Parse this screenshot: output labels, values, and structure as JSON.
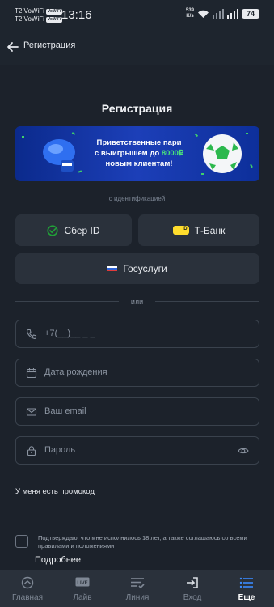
{
  "status_bar": {
    "carrier_line1": "T2 VoWiFi",
    "carrier_line2": "T2 VoWiFi",
    "volte_badge": "VoWiFi",
    "time": "13:16",
    "speed_value": "539",
    "speed_unit": "K/s",
    "battery": "74"
  },
  "header": {
    "title": "Регистрация"
  },
  "page_title": "Регистрация",
  "banner": {
    "line1": "Приветственные пари",
    "line2_prefix": "с выигрышем до ",
    "line2_highlight": "8000₽",
    "line3": "новым клиентам!",
    "highlight_color": "#49e27a"
  },
  "identification_caption": "с идентификацией",
  "buttons": {
    "sber": "Сбер ID",
    "tbank": "Т-Банк",
    "tbank_badge": "ID",
    "gosuslugi": "Госуслуги"
  },
  "or_text": "или",
  "fields": {
    "phone_placeholder": "+7(__)__ _ _",
    "birthdate_placeholder": "Дата рождения",
    "email_placeholder": "Ваш email",
    "password_placeholder": "Пароль"
  },
  "promo_label": "У меня есть промокод",
  "consent_text": "Подтверждаю, что мне исполнилось 18 лет, а также соглашаюсь со всеми правилами и положениями",
  "more_link": "Подробнее",
  "tabs": [
    {
      "label": "Главная",
      "icon": "home-icon"
    },
    {
      "label": "Лайв",
      "icon": "live-icon"
    },
    {
      "label": "Линия",
      "icon": "line-list-icon"
    },
    {
      "label": "Вход",
      "icon": "login-icon"
    },
    {
      "label": "Еще",
      "icon": "menu-icon",
      "active": true
    }
  ],
  "colors": {
    "background": "#1c222b",
    "card": "#2a313b",
    "sber_green": "#21a038",
    "tbank_yellow": "#ffdd2d",
    "accent_blue": "#3a8bff"
  }
}
